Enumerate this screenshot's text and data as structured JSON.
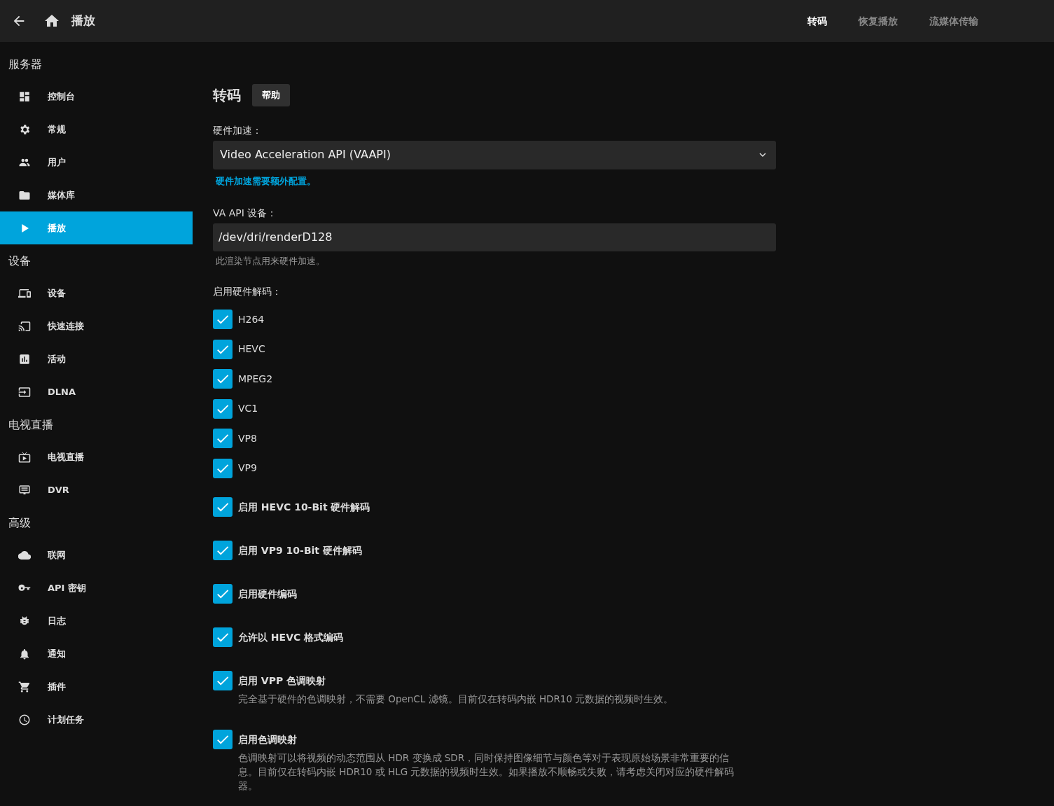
{
  "header": {
    "title": "播放",
    "tabs": [
      {
        "label": "转码",
        "selected": true
      },
      {
        "label": "恢复播放",
        "selected": false
      },
      {
        "label": "流媒体传输",
        "selected": false
      }
    ]
  },
  "sidebar": {
    "sections": [
      {
        "heading": "服务器",
        "items": [
          {
            "label": "控制台",
            "selected": false
          },
          {
            "label": "常规",
            "selected": false
          },
          {
            "label": "用户",
            "selected": false
          },
          {
            "label": "媒体库",
            "selected": false
          },
          {
            "label": "播放",
            "selected": true
          }
        ]
      },
      {
        "heading": "设备",
        "items": [
          {
            "label": "设备",
            "selected": false
          },
          {
            "label": "快速连接",
            "selected": false
          },
          {
            "label": "活动",
            "selected": false
          },
          {
            "label": "DLNA",
            "selected": false
          }
        ]
      },
      {
        "heading": "电视直播",
        "items": [
          {
            "label": "电视直播",
            "selected": false
          },
          {
            "label": "DVR",
            "selected": false
          }
        ]
      },
      {
        "heading": "高级",
        "items": [
          {
            "label": "联网",
            "selected": false
          },
          {
            "label": "API 密钥",
            "selected": false
          },
          {
            "label": "日志",
            "selected": false
          },
          {
            "label": "通知",
            "selected": false
          },
          {
            "label": "插件",
            "selected": false
          },
          {
            "label": "计划任务",
            "selected": false
          }
        ]
      }
    ]
  },
  "content": {
    "title": "转码",
    "help_button": "帮助",
    "hw_accel": {
      "label": "硬件加速：",
      "value": "Video Acceleration API (VAAPI)",
      "link": "硬件加速需要额外配置。"
    },
    "device": {
      "label": "VA API 设备：",
      "value": "/dev/dri/renderD128",
      "hint": "此渲染节点用来硬件加速。"
    },
    "decoding": {
      "label": "启用硬件解码：",
      "codecs": [
        {
          "label": "H264",
          "checked": true
        },
        {
          "label": "HEVC",
          "checked": true
        },
        {
          "label": "MPEG2",
          "checked": true
        },
        {
          "label": "VC1",
          "checked": true
        },
        {
          "label": "VP8",
          "checked": true
        },
        {
          "label": "VP9",
          "checked": true
        }
      ]
    },
    "options": [
      {
        "label": "启用 HEVC 10-Bit 硬件解码",
        "checked": true
      },
      {
        "label": "启用 VP9 10-Bit 硬件解码",
        "checked": true
      },
      {
        "label": "启用硬件编码",
        "checked": true
      },
      {
        "label": "允许以 HEVC 格式编码",
        "checked": true
      },
      {
        "label": "启用 VPP 色调映射",
        "checked": true,
        "description": "完全基于硬件的色调映射，不需要 OpenCL 滤镜。目前仅在转码内嵌 HDR10 元数据的视频时生效。"
      },
      {
        "label": "启用色调映射",
        "checked": true,
        "description": "色调映射可以将视频的动态范围从 HDR 变换成 SDR，同时保持图像细节与颜色等对于表现原始场景非常重要的信息。目前仅在转码内嵌 HDR10 或 HLG 元数据的视频时生效。如果播放不顺畅或失败，请考虑关闭对应的硬件解码器。"
      }
    ]
  }
}
